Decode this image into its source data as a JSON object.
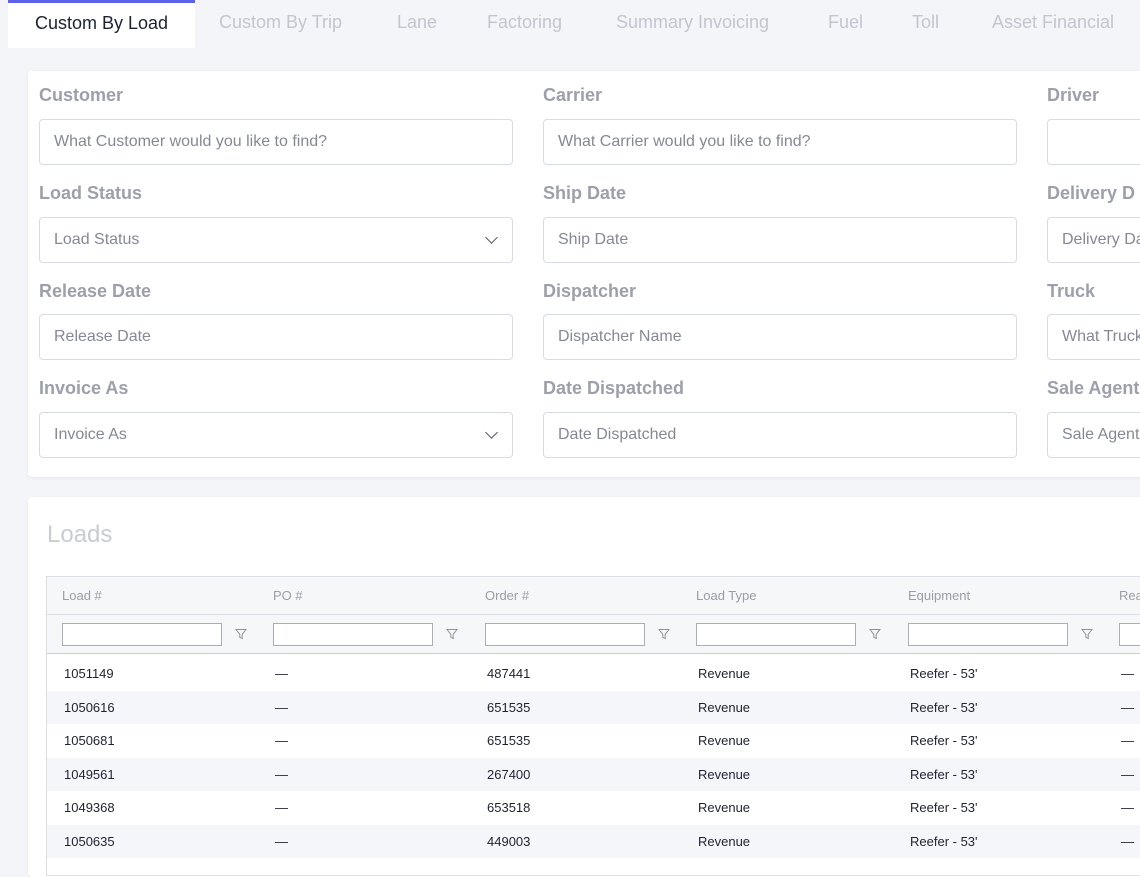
{
  "tabs": [
    {
      "label": "Custom By Load",
      "active": true
    },
    {
      "label": "Custom By Trip",
      "active": false
    },
    {
      "label": "Lane",
      "active": false
    },
    {
      "label": "Factoring",
      "active": false
    },
    {
      "label": "Summary Invoicing",
      "active": false
    },
    {
      "label": "Fuel",
      "active": false
    },
    {
      "label": "Toll",
      "active": false
    },
    {
      "label": "Asset Financial",
      "active": false
    }
  ],
  "filters": {
    "customer": {
      "label": "Customer",
      "placeholder": "What Customer would you like to find?"
    },
    "carrier": {
      "label": "Carrier",
      "placeholder": "What Carrier would you like to find?"
    },
    "driver": {
      "label": "Driver",
      "placeholder": ""
    },
    "load_status": {
      "label": "Load Status",
      "placeholder": "Load Status"
    },
    "ship_date": {
      "label": "Ship Date",
      "placeholder": "Ship Date"
    },
    "delivery_date": {
      "label": "Delivery D",
      "placeholder": "Delivery Da"
    },
    "release_date": {
      "label": "Release Date",
      "placeholder": "Release Date"
    },
    "dispatcher": {
      "label": "Dispatcher",
      "placeholder": "Dispatcher Name"
    },
    "truck": {
      "label": "Truck",
      "placeholder": "What Truck"
    },
    "invoice_as": {
      "label": "Invoice As",
      "placeholder": "Invoice As"
    },
    "date_dispatched": {
      "label": "Date Dispatched",
      "placeholder": "Date Dispatched"
    },
    "sale_agent": {
      "label": "Sale Agent",
      "placeholder": "Sale Agent"
    }
  },
  "loads": {
    "title": "Loads",
    "columns": [
      "Load #",
      "PO #",
      "Order #",
      "Load Type",
      "Equipment",
      "Rea"
    ],
    "rows": [
      [
        "1051149",
        "—",
        "487441",
        "Revenue",
        "Reefer - 53'",
        "—"
      ],
      [
        "1050616",
        "—",
        "651535",
        "Revenue",
        "Reefer - 53'",
        "—"
      ],
      [
        "1050681",
        "—",
        "651535",
        "Revenue",
        "Reefer - 53'",
        "—"
      ],
      [
        "1049561",
        "—",
        "267400",
        "Revenue",
        "Reefer - 53'",
        "—"
      ],
      [
        "1049368",
        "—",
        "653518",
        "Revenue",
        "Reefer - 53'",
        "—"
      ],
      [
        "1050635",
        "—",
        "449003",
        "Revenue",
        "Reefer - 53'",
        "—"
      ]
    ]
  },
  "colors": {
    "accent": "#5b62e8",
    "label": "#9da0ab",
    "text": "#1f2230"
  }
}
